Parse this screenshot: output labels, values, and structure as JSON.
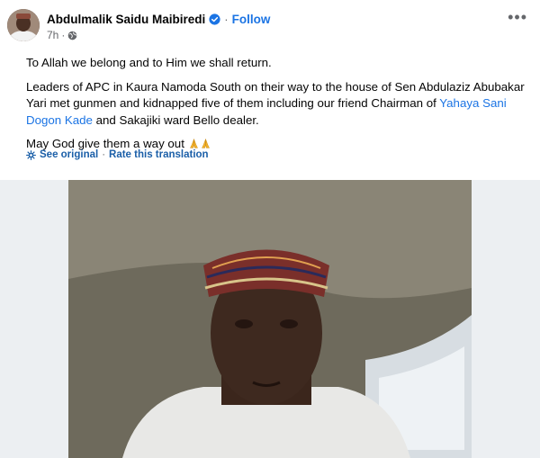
{
  "post": {
    "author": "Abdulmalik Saidu Maibiredi",
    "separator": "·",
    "follow_label": "Follow",
    "time": "7h",
    "meta_separator": "·",
    "audience_icon": "globe-icon",
    "more_icon": "more-options-icon",
    "more_label": "•••",
    "text": {
      "p1": "To Allah we belong and to Him we shall return.",
      "p2_part1": "Leaders of APC in Kaura Namoda South on their way to the house of Sen Abdulaziz Abubakar Yari met gunmen and kidnapped five of them including our friend Chairman of ",
      "p2_link": "Yahaya Sani Dogon Kade",
      "p2_part2": " and Sakajiki ward Bello dealer.",
      "p3": "May God give them a way out "
    },
    "translation": {
      "see_original": "See original",
      "dot": "·",
      "rate": "Rate this translation"
    }
  },
  "colors": {
    "link": "#1b74e4",
    "secondary_text": "#65676b",
    "verified_badge": "#1b74e4",
    "photo_background": "#eceff2"
  }
}
